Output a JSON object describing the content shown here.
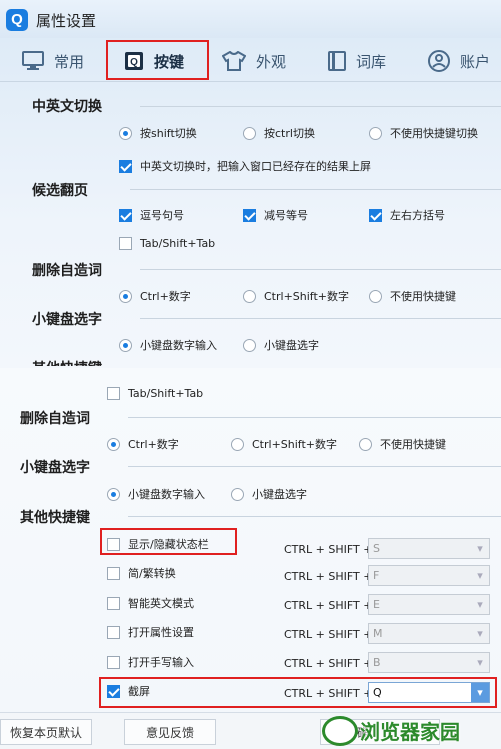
{
  "window": {
    "title": "属性设置",
    "logo_text": "Q"
  },
  "tabs": [
    {
      "label": "常用",
      "icon": "monitor-icon"
    },
    {
      "label": "按键",
      "icon": "keyboard-q-icon"
    },
    {
      "label": "外观",
      "icon": "shirt-icon"
    },
    {
      "label": "词库",
      "icon": "book-icon"
    },
    {
      "label": "账户",
      "icon": "user-icon"
    }
  ],
  "sections": {
    "switch": {
      "title": "中英文切换",
      "options": [
        "按shift切换",
        "按ctrl切换",
        "不使用快捷键切换"
      ],
      "selected": 0,
      "commit_label": "中英文切换时，把输入窗口已经存在的结果上屏",
      "commit_checked": true
    },
    "paging": {
      "title": "候选翻页",
      "options": [
        "逗号句号",
        "减号等号",
        "左右方括号",
        "Tab/Shift+Tab"
      ],
      "checked": [
        true,
        true,
        true,
        false
      ]
    },
    "delete_upper": {
      "title": "删除自造词",
      "options": [
        "Ctrl+数字",
        "Ctrl+Shift+数字",
        "不使用快捷键"
      ],
      "selected": 0
    },
    "keypad_upper": {
      "title": "小键盘选字",
      "options": [
        "小键盘数字输入",
        "小键盘选字"
      ],
      "selected": 0
    },
    "other_partial": {
      "title": "其他快捷键"
    },
    "paging_lower": {
      "option": "Tab/Shift+Tab",
      "checked": false
    },
    "delete_lower": {
      "title": "删除自造词",
      "options": [
        "Ctrl+数字",
        "Ctrl+Shift+数字",
        "不使用快捷键"
      ],
      "selected": 0
    },
    "keypad_lower": {
      "title": "小键盘选字",
      "options": [
        "小键盘数字输入",
        "小键盘选字"
      ],
      "selected": 0
    },
    "shortcuts": {
      "title": "其他快捷键",
      "items": [
        {
          "label": "显示/隐藏状态栏",
          "checked": false,
          "keys": "CTRL + SHIFT +",
          "key": "S"
        },
        {
          "label": "简/繁转换",
          "checked": false,
          "keys": "CTRL + SHIFT +",
          "key": "F"
        },
        {
          "label": "智能英文模式",
          "checked": false,
          "keys": "CTRL + SHIFT +",
          "key": "E"
        },
        {
          "label": "打开属性设置",
          "checked": false,
          "keys": "CTRL + SHIFT +",
          "key": "M"
        },
        {
          "label": "打开手写输入",
          "checked": false,
          "keys": "CTRL + SHIFT +",
          "key": "B"
        },
        {
          "label": "截屏",
          "checked": true,
          "keys": "CTRL + SHIFT +",
          "key": "Q"
        }
      ]
    }
  },
  "footer": {
    "restore_label": "恢复本页默认",
    "feedback_label": "意见反馈",
    "ok_partial": "确"
  },
  "watermark": {
    "text": "浏览器家园"
  },
  "colors": {
    "accent": "#1a7de0",
    "highlight": "#e02020",
    "watermark": "#2c8a2c"
  }
}
